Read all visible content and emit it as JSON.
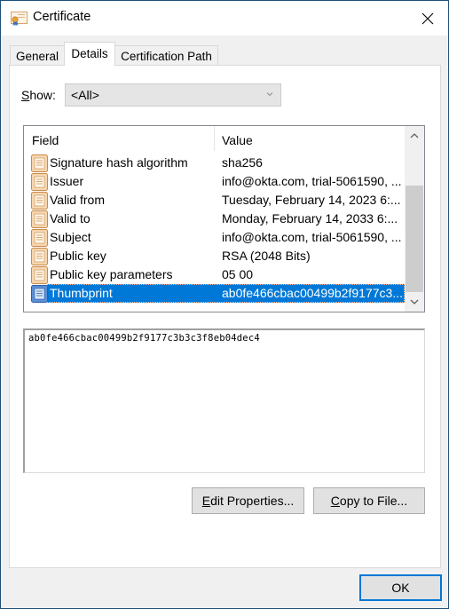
{
  "window": {
    "title": "Certificate",
    "icon": "certificate-icon",
    "close_icon": "close-icon"
  },
  "tabs": [
    {
      "label": "General",
      "active": false
    },
    {
      "label": "Details",
      "active": true
    },
    {
      "label": "Certification Path",
      "active": false
    }
  ],
  "show": {
    "label_accel": "S",
    "label_rest": "how:",
    "selected": "<All>",
    "chevron_icon": "chevron-down-icon"
  },
  "listview": {
    "columns": {
      "field": "Field",
      "value": "Value"
    },
    "rows": [
      {
        "field": "Signature hash algorithm",
        "value": "sha256",
        "selected": false
      },
      {
        "field": "Issuer",
        "value": "info@okta.com, trial-5061590, ...",
        "selected": false
      },
      {
        "field": "Valid from",
        "value": "Tuesday, February 14, 2023 6:...",
        "selected": false
      },
      {
        "field": "Valid to",
        "value": "Monday, February 14, 2033 6:...",
        "selected": false
      },
      {
        "field": "Subject",
        "value": "info@okta.com, trial-5061590, ...",
        "selected": false
      },
      {
        "field": "Public key",
        "value": "RSA (2048 Bits)",
        "selected": false
      },
      {
        "field": "Public key parameters",
        "value": "05 00",
        "selected": false
      },
      {
        "field": "Thumbprint",
        "value": "ab0fe466cbac00499b2f9177c3...",
        "selected": true
      }
    ],
    "scroll_position": 0.55
  },
  "detail_text": "ab0fe466cbac00499b2f9177c3b3c3f8eb04dec4",
  "buttons": {
    "edit_properties_accel": "E",
    "edit_properties_rest": "dit Properties...",
    "copy_to_file_accel": "C",
    "copy_to_file_rest": "opy to File...",
    "ok": "OK"
  },
  "colors": {
    "selection": "#0078d7",
    "window_border": "#1c4f78",
    "dialog_bg": "#f0f0f0"
  }
}
